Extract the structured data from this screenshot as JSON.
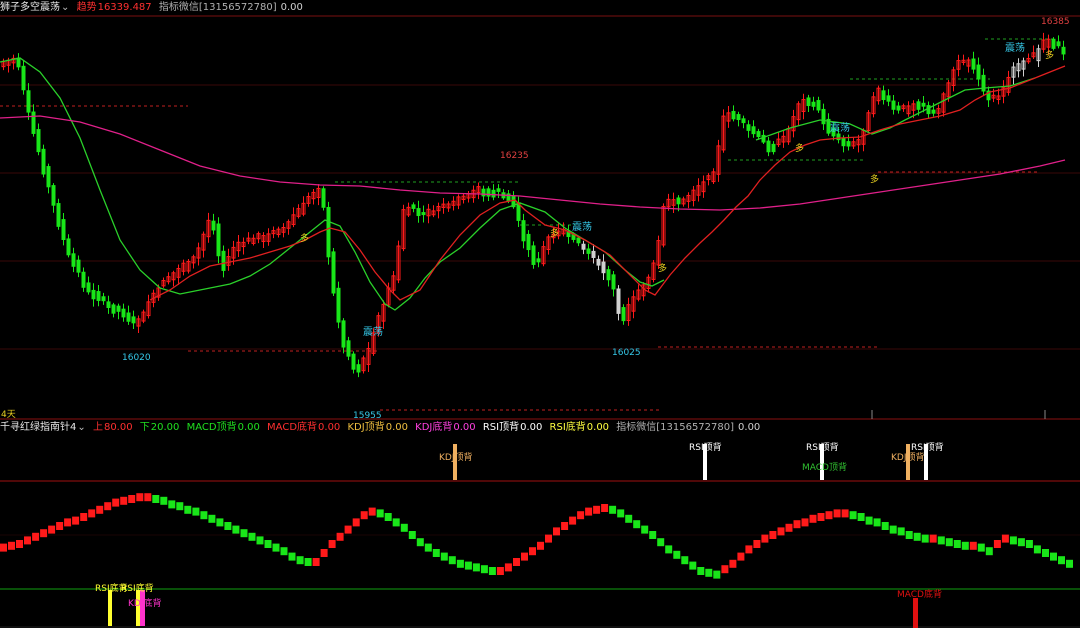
{
  "colors": {
    "up": "#ff1a1a",
    "down": "#19e619",
    "neutral": "#d0d0d0",
    "ma_fast": "#e02020",
    "ma_slow": "#2ad02a",
    "ma_long": "#e0208a",
    "price_label": "#e04040",
    "low_label": "#35c8e8",
    "kdj_top": "#f0b060",
    "rsi": "#ffffff",
    "macd_top": "#30c030",
    "magenta": "#ff33cc",
    "yellow": "#ffff30",
    "macd_bottom": "#e01010"
  },
  "top_header": {
    "title": "狮子多空震荡",
    "dropdown_icon": "chevron-down-icon",
    "trend_label": "趋势",
    "trend_value": "16339.487",
    "indicator_label": "指标微信[13156572780]",
    "indicator_value": "0.00"
  },
  "top_labels": {
    "high_1": "16385",
    "high_2": "16235",
    "low_1": "16020",
    "low_2": "15955",
    "low_3": "16025",
    "zhendang": "震荡",
    "duo": "多",
    "period": "4天"
  },
  "bottom_header": {
    "title": "千寻红绿指南针4",
    "up_label": "上",
    "up_value": "80.00",
    "down_label": "下",
    "down_value": "20.00",
    "macd_top_label": "MACD顶背",
    "macd_top_value": "0.00",
    "macd_bottom_label": "MACD底背",
    "macd_bottom_value": "0.00",
    "kdj_top_label": "KDJ顶背",
    "kdj_top_value": "0.00",
    "kdj_bottom_label": "KDJ底背",
    "kdj_bottom_value": "0.00",
    "rsi_top_label": "RSI顶背",
    "rsi_top_value": "0.00",
    "rsi_bottom_label": "RSI底背",
    "rsi_bottom_value": "0.00",
    "indicator_label": "指标微信[13156572780]",
    "indicator_value": "0.00"
  },
  "bottom_labels": {
    "kdj_top": "KDJ顶背",
    "rsi_top": "RSI顶背",
    "macd_top": "MACD顶背",
    "rsi_bottom": "RSI底背",
    "kdj_bottom": "KDJ底背",
    "macd_bottom": "MACD底背"
  },
  "oscillator": [
    43,
    44,
    45,
    47,
    49,
    51,
    53,
    55,
    57,
    58,
    60,
    62,
    64,
    66,
    68,
    69,
    70,
    71,
    71,
    70,
    69,
    67,
    66,
    64,
    63,
    61,
    59,
    57,
    55,
    53,
    51,
    49,
    47,
    45,
    43,
    41,
    38,
    36,
    35,
    35,
    40,
    45,
    49,
    53,
    57,
    61,
    63,
    62,
    60,
    57,
    54,
    50,
    46,
    43,
    40,
    38,
    36,
    34,
    33,
    32,
    31,
    30,
    30,
    32,
    35,
    38,
    41,
    44,
    48,
    52,
    55,
    58,
    61,
    63,
    64,
    65,
    64,
    62,
    59,
    56,
    53,
    50,
    46,
    42,
    39,
    36,
    33,
    30,
    29,
    28,
    31,
    34,
    38,
    42,
    45,
    48,
    50,
    52,
    54,
    56,
    57,
    59,
    60,
    61,
    62,
    62,
    61,
    60,
    58,
    57,
    55,
    53,
    52,
    50,
    49,
    48,
    48,
    47,
    46,
    45,
    44,
    44,
    43,
    41,
    45,
    48,
    47,
    46,
    45,
    42,
    40,
    38,
    36,
    34
  ]
}
